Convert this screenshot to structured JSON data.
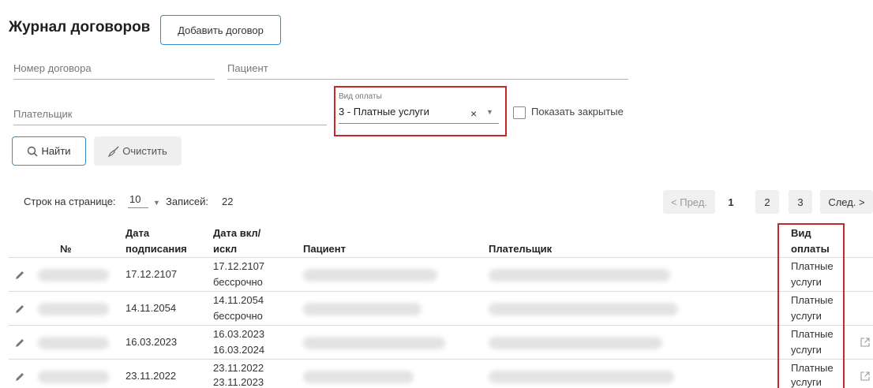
{
  "header": {
    "title": "Журнал договоров",
    "add_button": "Добавить договор"
  },
  "filters": {
    "contract_number_placeholder": "Номер договора",
    "patient_placeholder": "Пациент",
    "payer_placeholder": "Плательщик",
    "payment_type_label": "Вид оплаты",
    "payment_type_value": "3 - Платные услуги",
    "clear_symbol": "×",
    "show_closed_label": "Показать закрытые",
    "show_closed_checked": false
  },
  "actions": {
    "find_label": "Найти",
    "clear_label": "Очистить"
  },
  "listing": {
    "rows_per_page_label": "Строк на странице:",
    "rows_per_page_value": "10",
    "records_label": "Записей:",
    "records_value": "22"
  },
  "pagination": {
    "prev_label": "< Пред.",
    "next_label": "След. >",
    "pages": [
      "1",
      "2",
      "3"
    ],
    "current_page": "1"
  },
  "table": {
    "columns": {
      "number": "№",
      "sign_date_1": "Дата",
      "sign_date_2": "подписания",
      "incl_date_1": "Дата вкл/",
      "incl_date_2": "искл",
      "patient": "Пациент",
      "payer": "Плательщик",
      "paytype_1": "Вид",
      "paytype_2": "оплаты"
    },
    "rows": [
      {
        "sign_date": "17.12.2107",
        "incl_date": "17.12.2107",
        "excl_date": "бессрочно",
        "pay_1": "Платные",
        "pay_2": "услуги",
        "external": false
      },
      {
        "sign_date": "14.11.2054",
        "incl_date": "14.11.2054",
        "excl_date": "бессрочно",
        "pay_1": "Платные",
        "pay_2": "услуги",
        "external": false
      },
      {
        "sign_date": "16.03.2023",
        "incl_date": "16.03.2023",
        "excl_date": "16.03.2024",
        "pay_1": "Платные",
        "pay_2": "услуги",
        "external": true
      },
      {
        "sign_date": "23.11.2022",
        "incl_date": "23.11.2022",
        "excl_date": "23.11.2023",
        "pay_1": "Платные",
        "pay_2": "услуги",
        "external": true
      }
    ]
  },
  "colors": {
    "accent_border": "#3c8fc4",
    "highlight_red": "#c62828"
  }
}
